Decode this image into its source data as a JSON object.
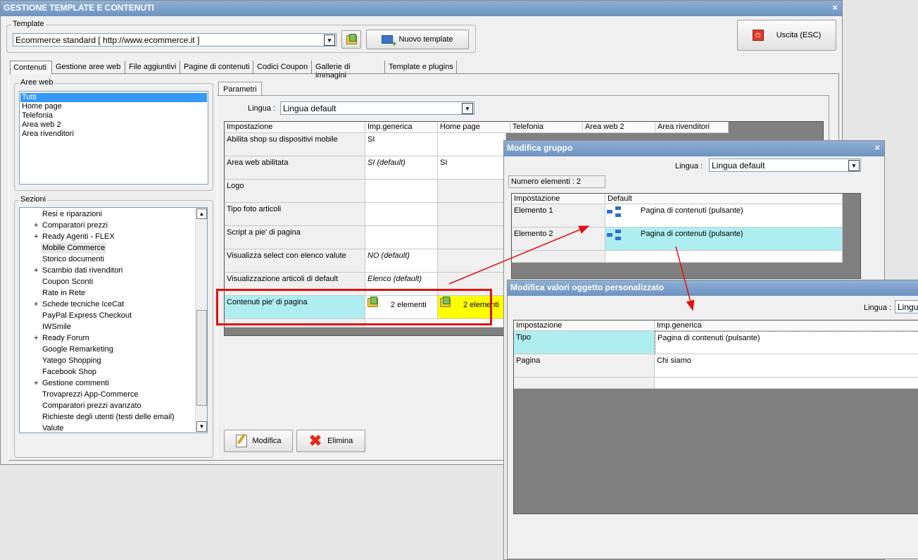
{
  "window": {
    "title": "GESTIONE TEMPLATE E CONTENUTI",
    "close_label": "×"
  },
  "template": {
    "group_label": "Template",
    "selected": "Ecommerce standard [ http://www.ecommerce.it ]",
    "new_button": "Nuovo template",
    "exit_button": "Uscita (ESC)"
  },
  "tabs": [
    "Contenuti",
    "Gestione aree web",
    "File aggiuntivi",
    "Pagine di contenuti",
    "Codici Coupon",
    "Gallerie di immagini",
    "Template e plugins"
  ],
  "aree_web": {
    "label": "Aree web",
    "items": [
      "Tutti",
      "Home page",
      "Telefonia",
      "Area web 2",
      "Area rivenditori"
    ]
  },
  "sezioni": {
    "label": "Sezioni",
    "items": [
      {
        "label": "Resi e riparazioni",
        "expand": ""
      },
      {
        "label": "Comparatori prezzi",
        "expand": "+"
      },
      {
        "label": "Ready Agenti - FLEX",
        "expand": "+"
      },
      {
        "label": "Mobile Commerce",
        "expand": ""
      },
      {
        "label": "Storico documenti",
        "expand": ""
      },
      {
        "label": "Scambio dati rivenditori",
        "expand": "+"
      },
      {
        "label": "Coupon Sconti",
        "expand": ""
      },
      {
        "label": "Rate in Rete",
        "expand": ""
      },
      {
        "label": "Schede tecniche IceCat",
        "expand": "+"
      },
      {
        "label": "PayPal Express Checkout",
        "expand": ""
      },
      {
        "label": "IWSmile",
        "expand": ""
      },
      {
        "label": "Ready Forum",
        "expand": "+"
      },
      {
        "label": "Google Remarketing",
        "expand": ""
      },
      {
        "label": "Yatego Shopping",
        "expand": ""
      },
      {
        "label": "Facebook Shop",
        "expand": ""
      },
      {
        "label": "Gestione commenti",
        "expand": "+"
      },
      {
        "label": "Trovaprezzi App-Commerce",
        "expand": ""
      },
      {
        "label": "Comparatori prezzi avanzato",
        "expand": ""
      },
      {
        "label": "Richieste degli utenti (testi delle email)",
        "expand": ""
      },
      {
        "label": "Valute",
        "expand": ""
      }
    ]
  },
  "parametri": {
    "tab_label": "Parametri",
    "lingua_label": "Lingua :",
    "lingua_value": "Lingua default",
    "columns": [
      "Impostazione",
      "Imp.generica",
      "Home page",
      "Telefonia",
      "Area web 2",
      "Area rivenditori"
    ],
    "rows": [
      {
        "name": "Abilita shop su dispositivi mobile",
        "generica": "SI",
        "home": ""
      },
      {
        "name": "Area web abilitata",
        "generica": "SI (default)",
        "home": "SI"
      },
      {
        "name": "Logo",
        "generica": "",
        "home": ""
      },
      {
        "name": "Tipo foto articoli",
        "generica": "",
        "home": ""
      },
      {
        "name": "Script a pie' di pagina",
        "generica": "",
        "home": ""
      },
      {
        "name": "Visualizza select con elenco valute",
        "generica": "NO (default)",
        "home": ""
      },
      {
        "name": "Visualizzazione articoli di default",
        "generica": "Elenco (default)",
        "home": ""
      },
      {
        "name": "Contenuti pie' di pagina",
        "generica": "2 elementi",
        "home": "2 elementi"
      }
    ],
    "modifica_button": "Modifica",
    "elimina_button": "Elimina"
  },
  "modifica_gruppo": {
    "title": "Modifica gruppo",
    "lingua_label": "Lingua :",
    "lingua_value": "Lingua default",
    "count_label": "Numero elementi : 2",
    "columns": [
      "Impostazione",
      "Default"
    ],
    "rows": [
      {
        "name": "Elemento 1",
        "value": "Pagina di contenuti (pulsante)"
      },
      {
        "name": "Elemento 2",
        "value": "Pagina di contenuti (pulsante)"
      }
    ]
  },
  "modifica_valori": {
    "title": "Modifica valori oggetto personalizzato",
    "lingua_label": "Lingua :",
    "lingua_value": "Lingua",
    "columns": [
      "Impostazione",
      "Imp.generica"
    ],
    "rows": [
      {
        "name": "Tipo",
        "value": "Pagina di contenuti (pulsante)"
      },
      {
        "name": "Pagina",
        "value": "Chi siamo"
      }
    ]
  },
  "colors": {
    "title_bar": "#7a9cc7",
    "selected_row": "#aeeef0",
    "highlight_yellow": "#ffff00",
    "annotation_red": "#e01010"
  }
}
